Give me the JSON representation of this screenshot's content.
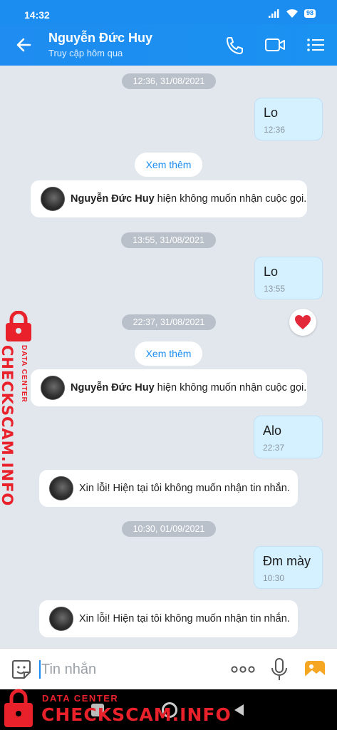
{
  "status_bar": {
    "time": "14:32",
    "battery": "98"
  },
  "header": {
    "contact_name": "Nguyễn Đức Huy",
    "contact_status": "Truy cập hôm qua"
  },
  "messages": {
    "ts1": "12:36, 31/08/2021",
    "out1": {
      "text": "Lo",
      "time": "12:36"
    },
    "see_more_1": "Xem thêm",
    "sys1": {
      "name": "Nguyễn Đức Huy",
      "text": "hiện không muốn nhận cuộc gọi."
    },
    "ts2": "13:55, 31/08/2021",
    "out2": {
      "text": "Lo",
      "time": "13:55"
    },
    "ts3": "22:37, 31/08/2021",
    "see_more_2": "Xem thêm",
    "sys2": {
      "name": "Nguyễn Đức Huy",
      "text": "hiện không muốn nhận cuộc gọi."
    },
    "out3": {
      "text": "Alo",
      "time": "22:37"
    },
    "auto1": "Xin lỗi! Hiện tại tôi không muốn nhận tin nhắn.",
    "ts4": "10:30, 01/09/2021",
    "out4": {
      "text": "Đm mày",
      "time": "10:30"
    },
    "auto2": "Xin lỗi! Hiện tại tôi không muốn nhận tin nhắn."
  },
  "composer": {
    "placeholder": "Tin nhắn"
  },
  "watermark": {
    "brand": "CHECKSCAM.INFO",
    "sub": "DATA CENTER"
  },
  "colors": {
    "accent": "#1b8cf0",
    "bubble_out": "#d5f1ff",
    "watermark": "#e8212b"
  },
  "icons": [
    "back-arrow-icon",
    "phone-icon",
    "video-call-icon",
    "menu-list-icon",
    "heart-icon",
    "sticker-icon",
    "more-icon",
    "mic-icon",
    "image-icon",
    "lock-icon"
  ]
}
